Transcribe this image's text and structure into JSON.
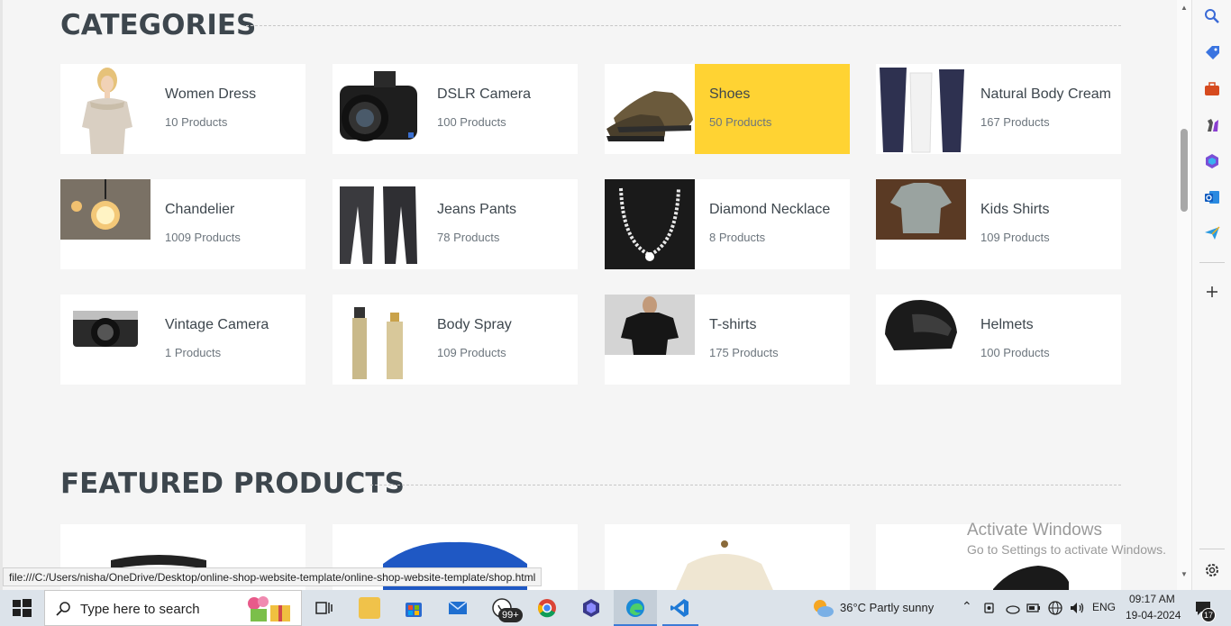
{
  "categories_section": {
    "title": "CATEGORIES",
    "items": [
      {
        "name": "Women Dress",
        "count": "10 Products",
        "thumb": "woman-dress-photo"
      },
      {
        "name": "DSLR Camera",
        "count": "100 Products",
        "thumb": "dslr-camera-photo"
      },
      {
        "name": "Shoes",
        "count": "50 Products",
        "thumb": "shoes-photo",
        "highlighted": true
      },
      {
        "name": "Natural Body Cream",
        "count": "167 Products",
        "thumb": "body-cream-photo"
      },
      {
        "name": "Chandelier",
        "count": "1009 Products",
        "thumb": "chandelier-photo"
      },
      {
        "name": "Jeans Pants",
        "count": "78 Products",
        "thumb": "jeans-photo"
      },
      {
        "name": "Diamond Necklace",
        "count": "8 Products",
        "thumb": "necklace-photo"
      },
      {
        "name": "Kids Shirts",
        "count": "109 Products",
        "thumb": "kids-shirt-photo"
      },
      {
        "name": "Vintage Camera",
        "count": "1 Products",
        "thumb": "vintage-camera-photo"
      },
      {
        "name": "Body Spray",
        "count": "109 Products",
        "thumb": "body-spray-photo"
      },
      {
        "name": "T-shirts",
        "count": "175 Products",
        "thumb": "tshirt-photo"
      },
      {
        "name": "Helmets",
        "count": "100 Products",
        "thumb": "helmet-photo"
      }
    ]
  },
  "featured_section": {
    "title": "FEATURED PRODUCTS"
  },
  "status_url": "file:///C:/Users/nisha/OneDrive/Desktop/online-shop-website-template/online-shop-website-template/shop.html",
  "watermark": {
    "line1": "Activate Windows",
    "line2": "Go to Settings to activate Windows."
  },
  "sidebar": {
    "icons": [
      "search-icon",
      "tag-icon",
      "briefcase-icon",
      "chess-icon",
      "copilot-icon",
      "outlook-icon",
      "send-icon",
      "add-icon",
      "settings-icon"
    ]
  },
  "taskbar": {
    "search_placeholder": "Type here to search",
    "whatsapp_badge": "99+",
    "weather": "36°C  Partly sunny",
    "language": "ENG",
    "time": "09:17 AM",
    "date": "19-04-2024",
    "notification_count": "17"
  },
  "colors": {
    "accent_yellow": "#ffd333",
    "heading": "#3d464d",
    "page_bg": "#f5f5f5",
    "taskbar_bg": "#dce3ea"
  }
}
